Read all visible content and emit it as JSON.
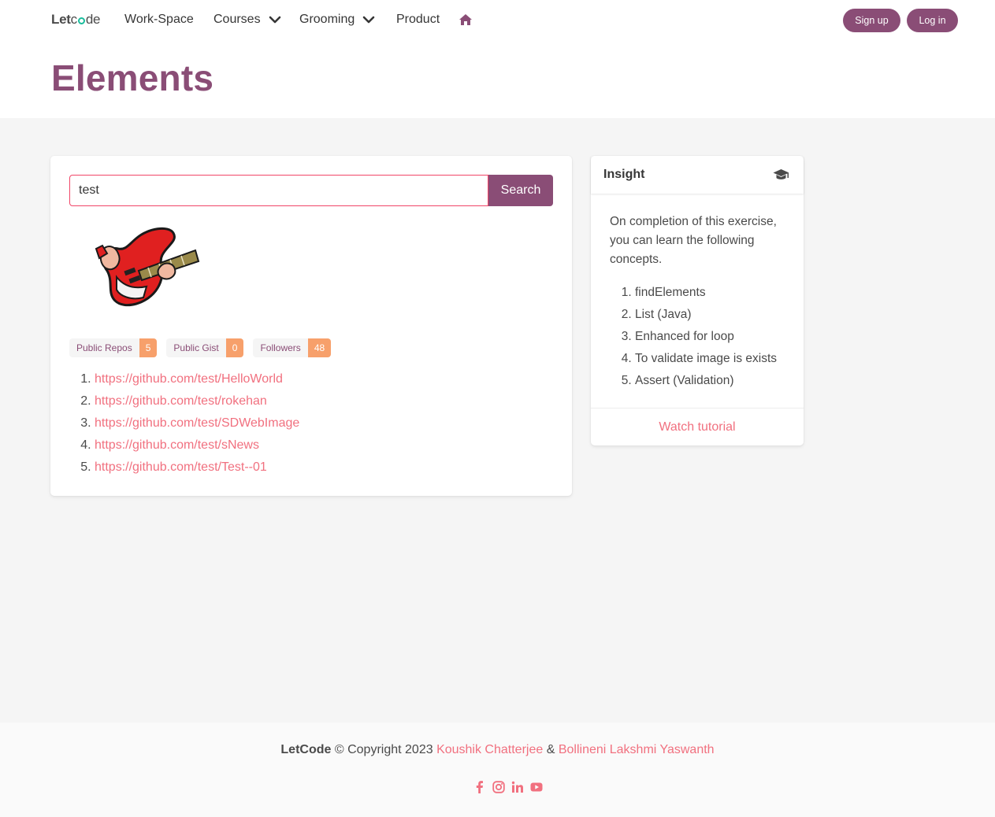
{
  "nav": {
    "brand_bold": "Let",
    "brand_light_1": "c",
    "brand_light_2": "de",
    "items": [
      {
        "label": "Work-Space"
      },
      {
        "label": "Courses"
      },
      {
        "label": "Grooming"
      },
      {
        "label": "Product"
      }
    ],
    "signup_label": "Sign up",
    "login_label": "Log in",
    "icons": {
      "home": "home-icon",
      "chevron": "chevron-down-icon"
    }
  },
  "hero": {
    "title": "Elements"
  },
  "search": {
    "value": "test",
    "button_label": "Search"
  },
  "profile": {
    "avatar_icon": "guitar-avatar-image",
    "stats": [
      {
        "label": "Public Repos",
        "count": "5"
      },
      {
        "label": "Public Gist",
        "count": "0"
      },
      {
        "label": "Followers",
        "count": "48"
      }
    ],
    "repos": [
      "https://github.com/test/HelloWorld",
      "https://github.com/test/rokehan",
      "https://github.com/test/SDWebImage",
      "https://github.com/test/sNews",
      "https://github.com/test/Test--01"
    ]
  },
  "insight": {
    "title": "Insight",
    "icon": "graduation-cap-icon",
    "intro": "On completion of this exercise, you can learn the following concepts.",
    "concepts": [
      "findElements",
      "List (Java)",
      "Enhanced for loop",
      "To validate image is exists",
      "Assert (Validation)"
    ],
    "footer_link": "Watch tutorial"
  },
  "footer": {
    "brand": "LetCode",
    "copyright": "© Copyright 2023",
    "author1": "Koushik Chatterjee",
    "amp": "&",
    "author2": "Bollineni Lakshmi Yaswanth",
    "social_icons": [
      "facebook-icon",
      "instagram-icon",
      "linkedin-icon",
      "youtube-icon"
    ]
  },
  "colors": {
    "brand": "#8a4d76",
    "link": "#f1707f",
    "tag_count": "#f7a06b",
    "input_border": "#f14668",
    "accent_green": "#1abc9c"
  }
}
